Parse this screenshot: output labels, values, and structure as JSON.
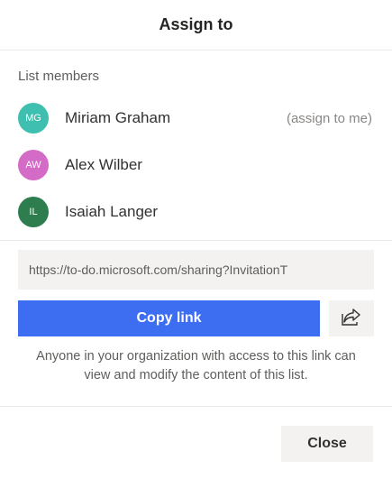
{
  "header": {
    "title": "Assign to"
  },
  "members": {
    "label": "List members",
    "items": [
      {
        "initials": "MG",
        "name": "Miriam Graham",
        "hint": "(assign to me)",
        "color": "#3fbfb0"
      },
      {
        "initials": "AW",
        "name": "Alex Wilber",
        "hint": "",
        "color": "#d46bc6"
      },
      {
        "initials": "IL",
        "name": "Isaiah Langer",
        "hint": "",
        "color": "#2e7d4f"
      }
    ]
  },
  "share": {
    "link": "https://to-do.microsoft.com/sharing?InvitationT",
    "copy_label": "Copy link",
    "share_icon": "share-icon",
    "note": "Anyone in your organization with access to this link can view and modify the content of this list."
  },
  "footer": {
    "close_label": "Close"
  },
  "colors": {
    "accent": "#3d6ef2",
    "button_bg": "#f3f2f1"
  }
}
